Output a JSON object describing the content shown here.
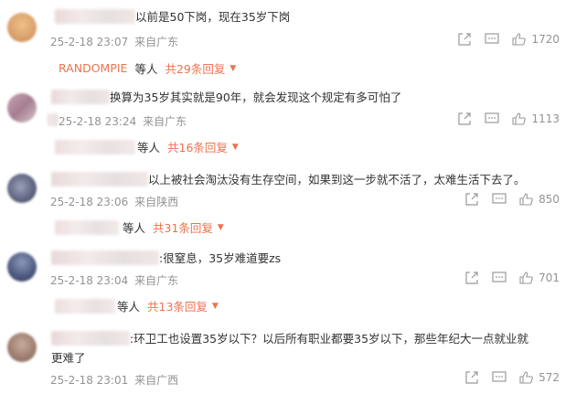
{
  "comments": [
    {
      "text": "以前是50下岗，现在35岁下岗",
      "time": "25-2-18 23:07",
      "location": "来自广东",
      "likes": "1720",
      "reply_user": "RANDOMPIE",
      "reply_who": "等人",
      "reply_count": "共29条回复",
      "avatar_color": "#d9a06b"
    },
    {
      "text": "换算为35岁其实就是90年，就会发现这个规定有多可怕了",
      "time": "25-2-18 23:24",
      "location": "来自广东",
      "likes": "1113",
      "reply_user": "",
      "reply_who": "等人",
      "reply_count": "共16条回复",
      "avatar_color": "#b98fa0"
    },
    {
      "text": "以上被社会淘汰没有生存空间，如果到这一步就不活了，太难生活下去了。",
      "time": "25-2-18 23:06",
      "location": "来自陕西",
      "likes": "850",
      "reply_user": "",
      "reply_who": "等人",
      "reply_count": "共31条回复",
      "avatar_color": "#7a7f95"
    },
    {
      "text": ":很窒息，35岁难道要zs",
      "time": "25-2-18 23:04",
      "location": "来自广东",
      "likes": "701",
      "reply_user": "",
      "reply_who": "等人",
      "reply_count": "共13条回复",
      "avatar_color": "#5d6a8c"
    },
    {
      "text": ":环卫工也设置35岁以下？以后所有职业都要35岁以下，那些年纪大一点就业就",
      "text2": "更难了",
      "time": "25-2-18 23:01",
      "location": "来自广西",
      "likes": "572",
      "avatar_color": "#a88a7a"
    }
  ],
  "icons": {
    "share": "share-icon",
    "comment": "comment-icon",
    "like": "thumbs-up-icon",
    "reply_toggle": "chevron-down-icon"
  },
  "colors": {
    "accent": "#eb7350",
    "meta": "#939393",
    "text": "#333333"
  }
}
